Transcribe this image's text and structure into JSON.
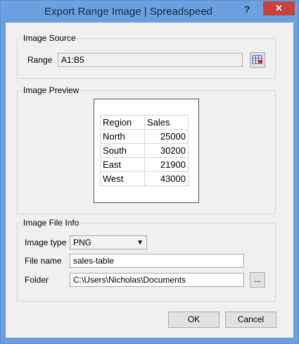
{
  "window": {
    "title": "Export Range Image  |  Spreadspeed",
    "help": "?",
    "close": "✕"
  },
  "image_source": {
    "group_label": "Image Source",
    "range_label": "Range",
    "range_value": "A1:B5"
  },
  "image_preview": {
    "group_label": "Image Preview",
    "headers": [
      "Region",
      "Sales"
    ],
    "rows": [
      [
        "North",
        "25000"
      ],
      [
        "South",
        "30200"
      ],
      [
        "East",
        "21900"
      ],
      [
        "West",
        "43000"
      ]
    ]
  },
  "image_file_info": {
    "group_label": "Image File Info",
    "type_label": "Image type",
    "type_value": "PNG",
    "file_name_label": "File name",
    "file_name_value": "sales-table",
    "folder_label": "Folder",
    "folder_value": "C:\\Users\\Nicholas\\Documents",
    "browse_label": "..."
  },
  "buttons": {
    "ok": "OK",
    "cancel": "Cancel"
  }
}
